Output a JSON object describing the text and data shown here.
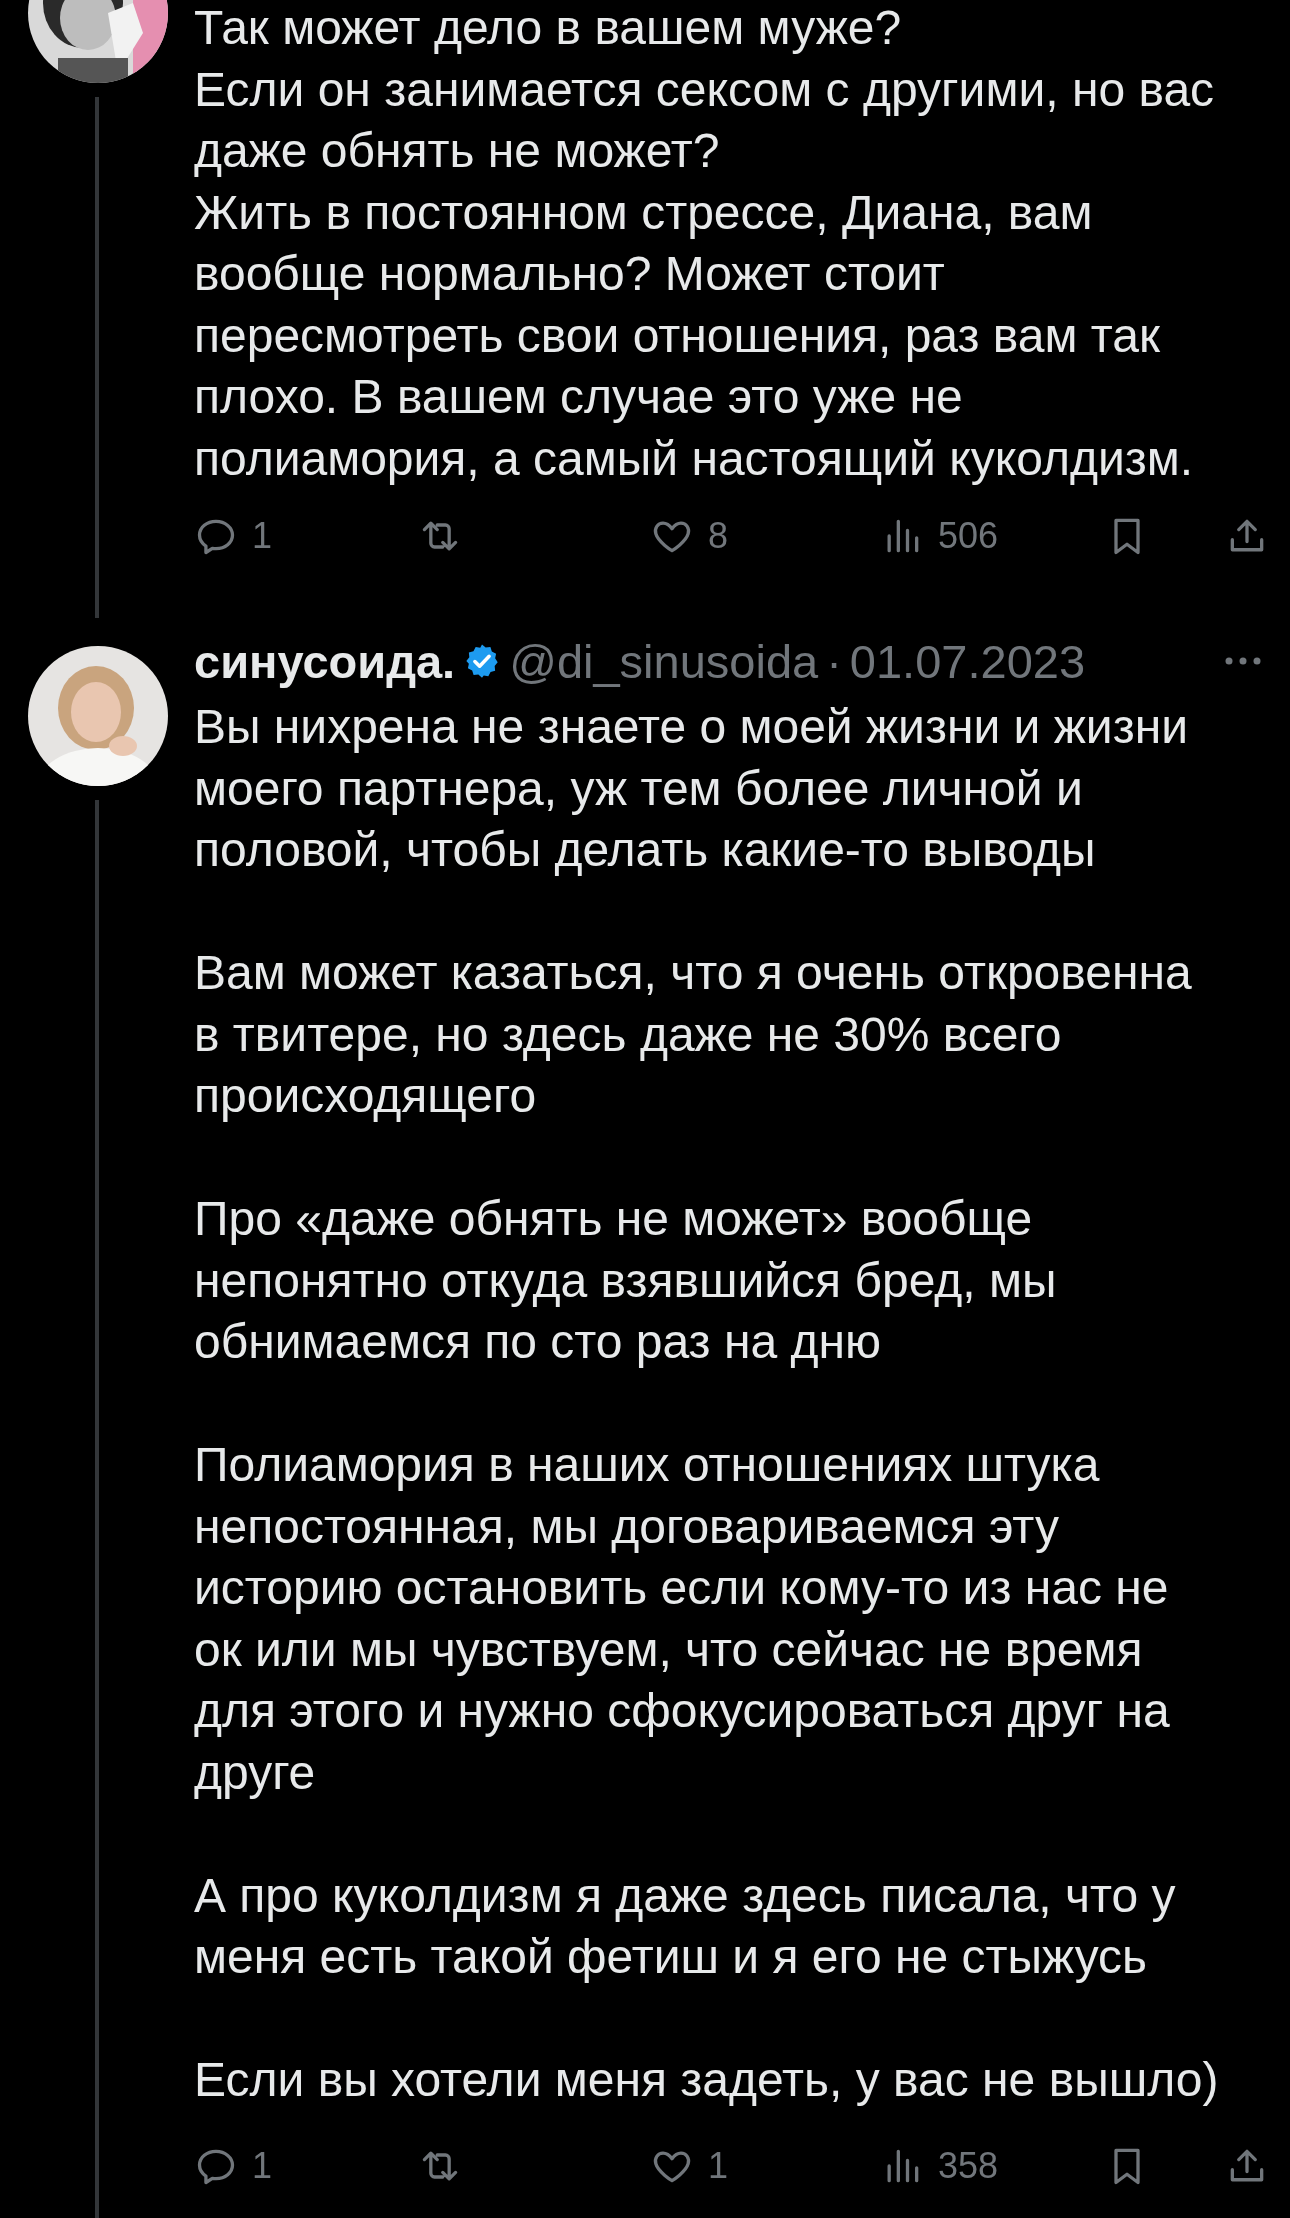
{
  "tweets": [
    {
      "avatar": {
        "kind": "picture",
        "cut": true
      },
      "paragraphs": [
        "Так может дело в вашем муже?\nЕсли он занимается сексом с другими, но вас\nдаже обнять не может?\nЖить в постоянном стрессе, Диана, вам\nвообще нормально? Может стоит\nпересмотреть свои отношения, раз вам так\nплохо. В вашем случае это уже не\nполиамория, а самый настоящий куколдизм."
      ],
      "actions": [
        {
          "kind": "reply",
          "count": "1"
        },
        {
          "kind": "retweet"
        },
        {
          "kind": "like",
          "count": "8"
        },
        {
          "kind": "views",
          "count": "506"
        },
        {
          "kind": "bookmark"
        },
        {
          "kind": "share"
        }
      ]
    },
    {
      "avatar": {
        "kind": "picture",
        "cut": false
      },
      "header": {
        "name": "синусоида.",
        "verified": true,
        "handle": "@di_sinusoida",
        "separator": "·",
        "date": "01.07.2023"
      },
      "paragraphs": [
        "Вы нихрена не знаете о моей жизни и жизни\nмоего партнера, уж тем более личной и\nполовой, чтобы делать какие-то выводы",
        "Вам может казаться, что я очень откровенна\nв твитере, но здесь даже не 30% всего\nпроисходящего",
        "Про «даже обнять не может» вообще\nнепонятно откуда взявшийся бред, мы\nобнимаемся по сто раз на дню",
        "Полиамория в наших отношениях штука\nнепостоянная, мы договариваемся эту\nисторию остановить если кому-то из нас не\nок или мы чувствуем, что сейчас не время\nдля этого и нужно сфокусироваться друг на\nдруге",
        "А про куколдизм я даже здесь писала, что у\nменя есть такой фетиш и я его не стыжусь",
        "Если вы хотели меня задеть, у вас не вышло)"
      ],
      "actions": [
        {
          "kind": "reply",
          "count": "1"
        },
        {
          "kind": "retweet"
        },
        {
          "kind": "like",
          "count": "1"
        },
        {
          "kind": "views",
          "count": "358"
        },
        {
          "kind": "bookmark"
        },
        {
          "kind": "share"
        }
      ]
    }
  ]
}
